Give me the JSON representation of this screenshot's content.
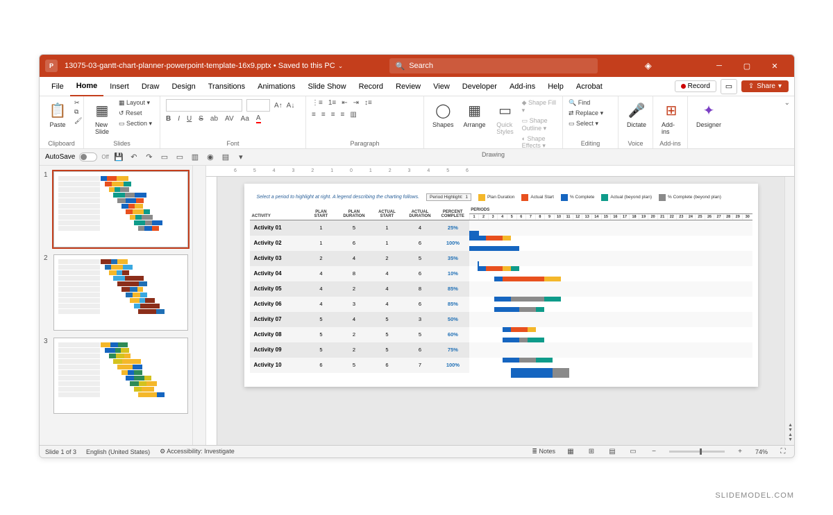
{
  "titlebar": {
    "app_icon_letter": "P",
    "doc_title": "13075-03-gantt-chart-planner-powerpoint-template-16x9.pptx • Saved to this PC",
    "search_placeholder": "Search"
  },
  "menu": {
    "tabs": [
      "File",
      "Home",
      "Insert",
      "Draw",
      "Design",
      "Transitions",
      "Animations",
      "Slide Show",
      "Record",
      "Review",
      "View",
      "Developer",
      "Add-ins",
      "Help",
      "Acrobat"
    ],
    "active": "Home",
    "record": "Record",
    "share": "Share"
  },
  "ribbon": {
    "clipboard": {
      "label": "Clipboard",
      "paste": "Paste"
    },
    "slides": {
      "label": "Slides",
      "new_slide": "New\nSlide",
      "layout": "Layout",
      "reset": "Reset",
      "section": "Section"
    },
    "font": {
      "label": "Font",
      "bold": "B",
      "italic": "I",
      "underline": "U",
      "strike": "S"
    },
    "paragraph": {
      "label": "Paragraph"
    },
    "drawing": {
      "label": "Drawing",
      "shapes": "Shapes",
      "arrange": "Arrange",
      "quick": "Quick\nStyles",
      "fill": "Shape Fill",
      "outline": "Shape Outline",
      "effects": "Shape Effects"
    },
    "editing": {
      "label": "Editing",
      "find": "Find",
      "replace": "Replace",
      "select": "Select"
    },
    "voice": {
      "label": "Voice",
      "dictate": "Dictate"
    },
    "addins": {
      "label": "Add-ins",
      "btn": "Add-ins"
    },
    "designer": {
      "label": "",
      "btn": "Designer"
    }
  },
  "qat": {
    "autosave": "AutoSave",
    "off": "Off"
  },
  "slide_content": {
    "caption": "Select a period to highlight at right. A legend describing the charting follows.",
    "period_highlight_label": "Period Highlight:",
    "period_highlight_value": "1",
    "legend": {
      "plan_duration": "Plan Duration",
      "actual_start": "Actual Start",
      "pct_complete": "% Complete",
      "actual_beyond": "Actual (beyond plan)",
      "pct_beyond": "% Complete (beyond plan)"
    },
    "headers": {
      "activity": "ACTIVITY",
      "plan_start": "PLAN\nSTART",
      "plan_duration": "PLAN\nDURATION",
      "actual_start": "ACTUAL\nSTART",
      "actual_duration": "ACTUAL\nDURATION",
      "percent_complete": "PERCENT\nCOMPLETE",
      "periods": "PERIODS"
    }
  },
  "chart_data": {
    "type": "bar",
    "title": "Gantt Chart Planner",
    "periods": 30,
    "legend_colors": {
      "plan_duration": "#f4b72a",
      "actual_start": "#e8501e",
      "pct_complete": "#1565c0",
      "actual_beyond": "#0e9b8a",
      "pct_beyond": "#8a8a8a"
    },
    "rows": [
      {
        "activity": "Activity 01",
        "plan_start": 1,
        "plan_duration": 5,
        "actual_start": 1,
        "actual_duration": 4,
        "pct": "25%",
        "segments": [
          {
            "start": 1,
            "len": 2,
            "color": "#1565c0"
          },
          {
            "start": 3,
            "len": 2,
            "color": "#e8501e"
          },
          {
            "start": 5,
            "len": 1,
            "color": "#f4b72a"
          }
        ]
      },
      {
        "activity": "Activity 02",
        "plan_start": 1,
        "plan_duration": 6,
        "actual_start": 1,
        "actual_duration": 6,
        "pct": "100%",
        "segments": [
          {
            "start": 1,
            "len": 6,
            "color": "#1565c0"
          }
        ]
      },
      {
        "activity": "Activity 03",
        "plan_start": 2,
        "plan_duration": 4,
        "actual_start": 2,
        "actual_duration": 5,
        "pct": "35%",
        "segments": [
          {
            "start": 2,
            "len": 1,
            "color": "#1565c0"
          },
          {
            "start": 3,
            "len": 2,
            "color": "#e8501e"
          },
          {
            "start": 5,
            "len": 1,
            "color": "#f4b72a"
          },
          {
            "start": 6,
            "len": 1,
            "color": "#0e9b8a"
          }
        ]
      },
      {
        "activity": "Activity 04",
        "plan_start": 4,
        "plan_duration": 8,
        "actual_start": 4,
        "actual_duration": 6,
        "pct": "10%",
        "segments": [
          {
            "start": 4,
            "len": 1,
            "color": "#1565c0"
          },
          {
            "start": 5,
            "len": 5,
            "color": "#e8501e"
          },
          {
            "start": 10,
            "len": 1,
            "color": "#f4b72a"
          },
          {
            "start": 11,
            "len": 1,
            "color": "#f4b72a"
          }
        ]
      },
      {
        "activity": "Activity 05",
        "plan_start": 4,
        "plan_duration": 2,
        "actual_start": 4,
        "actual_duration": 8,
        "pct": "85%",
        "segments": [
          {
            "start": 4,
            "len": 2,
            "color": "#1565c0"
          },
          {
            "start": 6,
            "len": 4,
            "color": "#8a8a8a"
          },
          {
            "start": 10,
            "len": 2,
            "color": "#0e9b8a"
          }
        ]
      },
      {
        "activity": "Activity 06",
        "plan_start": 4,
        "plan_duration": 3,
        "actual_start": 4,
        "actual_duration": 6,
        "pct": "85%",
        "segments": [
          {
            "start": 4,
            "len": 3,
            "color": "#1565c0"
          },
          {
            "start": 7,
            "len": 2,
            "color": "#8a8a8a"
          },
          {
            "start": 9,
            "len": 1,
            "color": "#0e9b8a"
          }
        ]
      },
      {
        "activity": "Activity 07",
        "plan_start": 5,
        "plan_duration": 4,
        "actual_start": 5,
        "actual_duration": 3,
        "pct": "50%",
        "segments": [
          {
            "start": 5,
            "len": 1,
            "color": "#1565c0"
          },
          {
            "start": 6,
            "len": 1,
            "color": "#e8501e"
          },
          {
            "start": 7,
            "len": 1,
            "color": "#e8501e"
          },
          {
            "start": 8,
            "len": 1,
            "color": "#f4b72a"
          }
        ]
      },
      {
        "activity": "Activity 08",
        "plan_start": 5,
        "plan_duration": 2,
        "actual_start": 5,
        "actual_duration": 5,
        "pct": "60%",
        "segments": [
          {
            "start": 5,
            "len": 2,
            "color": "#1565c0"
          },
          {
            "start": 7,
            "len": 1,
            "color": "#8a8a8a"
          },
          {
            "start": 8,
            "len": 2,
            "color": "#0e9b8a"
          }
        ]
      },
      {
        "activity": "Activity 09",
        "plan_start": 5,
        "plan_duration": 2,
        "actual_start": 5,
        "actual_duration": 6,
        "pct": "75%",
        "segments": [
          {
            "start": 5,
            "len": 2,
            "color": "#1565c0"
          },
          {
            "start": 7,
            "len": 2,
            "color": "#8a8a8a"
          },
          {
            "start": 9,
            "len": 2,
            "color": "#0e9b8a"
          }
        ]
      },
      {
        "activity": "Activity 10",
        "plan_start": 6,
        "plan_duration": 5,
        "actual_start": 6,
        "actual_duration": 7,
        "pct": "100%",
        "segments": [
          {
            "start": 6,
            "len": 5,
            "color": "#1565c0"
          },
          {
            "start": 11,
            "len": 2,
            "color": "#8a8a8a"
          }
        ]
      }
    ]
  },
  "status": {
    "slide_of": "Slide 1 of 3",
    "language": "English (United States)",
    "accessibility": "Accessibility: Investigate",
    "notes": "Notes",
    "zoom": "74%"
  },
  "watermark": "SLIDEMODEL.COM",
  "thumb_count": 3
}
